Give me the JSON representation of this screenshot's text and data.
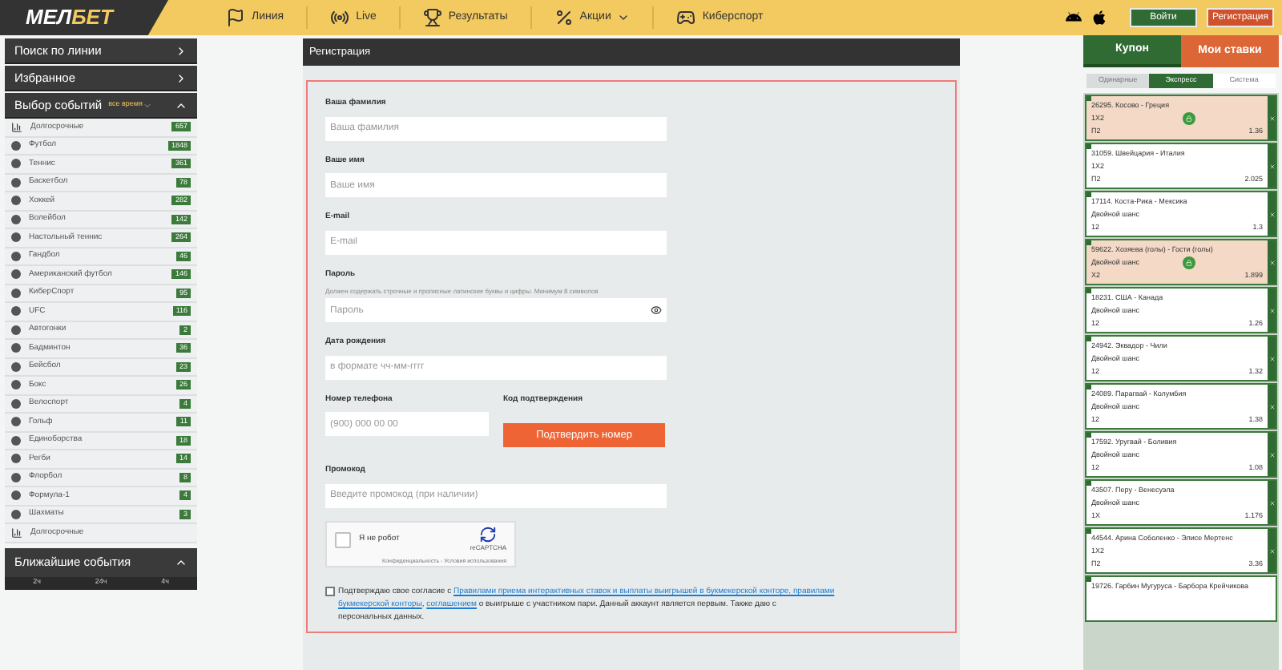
{
  "header": {
    "logo": [
      "МЕЛ",
      "БЕТ"
    ],
    "nav": [
      {
        "kind": "whistle",
        "label": "Линия",
        "dropdown": false
      },
      {
        "kind": "live",
        "label": "Live",
        "dropdown": false
      },
      {
        "kind": "trophy",
        "label": "Результаты",
        "dropdown": false
      },
      {
        "kind": "percent",
        "label": "Акции",
        "dropdown": true
      },
      {
        "kind": "cyber",
        "label": "Киберспорт",
        "dropdown": false
      }
    ],
    "login": "Войти",
    "register": "Регистрация"
  },
  "sidebar": {
    "search": "Поиск по линии",
    "favorites": "Избранное",
    "events_title": "Выбор событий",
    "events_filter": "все время",
    "sports": [
      {
        "name": "Долгосрочные",
        "count": "657"
      },
      {
        "name": "Футбол",
        "count": "1848"
      },
      {
        "name": "Теннис",
        "count": "361"
      },
      {
        "name": "Баскетбол",
        "count": "78"
      },
      {
        "name": "Хоккей",
        "count": "282"
      },
      {
        "name": "Волейбол",
        "count": "142"
      },
      {
        "name": "Настольный теннис",
        "count": "264"
      },
      {
        "name": "Гандбол",
        "count": "46"
      },
      {
        "name": "Американский футбол",
        "count": "146"
      },
      {
        "name": "КиберСпорт",
        "count": "95"
      },
      {
        "name": "UFC",
        "count": "116"
      },
      {
        "name": "Автогонки",
        "count": "2"
      },
      {
        "name": "Бадминтон",
        "count": "36"
      },
      {
        "name": "Бейсбол",
        "count": "23"
      },
      {
        "name": "Бокс",
        "count": "26"
      },
      {
        "name": "Велоспорт",
        "count": "4"
      },
      {
        "name": "Гольф",
        "count": "11"
      },
      {
        "name": "Единоборства",
        "count": "18"
      },
      {
        "name": "Регби",
        "count": "14"
      },
      {
        "name": "Флорбол",
        "count": "8"
      },
      {
        "name": "Формула-1",
        "count": "4"
      },
      {
        "name": "Шахматы",
        "count": "3"
      },
      {
        "name": "Долгосрочные"
      }
    ],
    "nearest_title": "Ближайшие события",
    "nearest_tabs": [
      {
        "label": "2ч",
        "selected": false
      },
      {
        "label": "24ч",
        "selected": false
      },
      {
        "label": "4ч",
        "selected": false
      }
    ]
  },
  "registration": {
    "title": "Регистрация",
    "fields": [
      {
        "label": "Ваша фамилия",
        "placeholder": "Ваша фамилия"
      },
      {
        "label": "Ваше имя",
        "placeholder": "Ваше имя"
      },
      {
        "label": "E-mail",
        "placeholder": "E-mail"
      },
      {
        "label": "Пароль",
        "hint": "Должен содержать строчные и прописные латинские буквы и цифры. Минимум 8 символов",
        "placeholder": "Пароль",
        "toggle": true
      },
      {
        "label": "Дата рождения",
        "placeholder": "в формате чч-мм-гггг"
      }
    ],
    "phone": {
      "label": "Номер телефона",
      "placeholder": "(900) 000 00 00"
    },
    "code": {
      "label": "Код подтверждения",
      "button": "Подтвердить номер"
    },
    "promo": {
      "label": "Промокод",
      "placeholder": "Введите промокод (при наличии)"
    },
    "captcha": {
      "checked": false,
      "label": "Я не робот",
      "brand": "reCAPTCHA",
      "links": "Конфиденциальность - Условия использования"
    },
    "consent": {
      "checked": false,
      "lines": [
        [
          {
            "text": "Подтверждаю свое согласие с "
          },
          {
            "link": "Правилами приема интерактивных ставок и выплаты выигрышей в букмекерской конторе, правилами"
          }
        ],
        [
          {
            "link": "букмекерской конторы"
          },
          {
            "text": ", "
          },
          {
            "link": "соглашением"
          },
          {
            "text": " о выигрыше с участником пари. Данный аккаунт является первым. Также даю с"
          }
        ],
        [
          {
            "text": "персональных данных."
          }
        ]
      ]
    }
  },
  "coupon": {
    "tabs": [
      {
        "label": "Купон",
        "selected": true
      },
      {
        "label": "Мои ставки",
        "selected": false
      }
    ],
    "types": [
      {
        "label": "Одинарные",
        "selected": false
      },
      {
        "label": "Экспресс",
        "selected": true
      },
      {
        "label": "Система",
        "selected": false
      }
    ],
    "bets": [
      {
        "event": "26295. Косово - Греция",
        "market": "1X2",
        "pick": "П2",
        "odds": "1.36",
        "blocked": true
      },
      {
        "event": "31059. Швейцария - Италия",
        "market": "1X2",
        "pick": "П2",
        "odds": "2.025",
        "blocked": false
      },
      {
        "event": "17114. Коста-Рика - Мексика",
        "market": "Двойной шанс",
        "pick": "12",
        "odds": "1.3",
        "blocked": false
      },
      {
        "event": "59622. Хозяева (голы) - Гости (голы)",
        "market": "Двойной шанс",
        "pick": "X2",
        "odds": "1.899",
        "blocked": true
      },
      {
        "event": "18231. США - Канада",
        "market": "Двойной шанс",
        "pick": "12",
        "odds": "1.26",
        "blocked": false
      },
      {
        "event": "24942. Эквадор - Чили",
        "market": "Двойной шанс",
        "pick": "12",
        "odds": "1.32",
        "blocked": false
      },
      {
        "event": "24089. Парагвай - Колумбия",
        "market": "Двойной шанс",
        "pick": "12",
        "odds": "1.38",
        "blocked": false
      },
      {
        "event": "17592. Уругвай - Боливия",
        "market": "Двойной шанс",
        "pick": "12",
        "odds": "1.08",
        "blocked": false
      },
      {
        "event": "43507. Перу - Венесуэла",
        "market": "Двойной шанс",
        "pick": "1X",
        "odds": "1.176",
        "blocked": false
      },
      {
        "event": "44544. Арина Соболенко - Элисе Мертенс",
        "market": "1X2",
        "pick": "П2",
        "odds": "3.36",
        "blocked": false
      },
      {
        "event": "19726. Гарбин Мугуруса - Барбора Крейчикова"
      }
    ]
  }
}
